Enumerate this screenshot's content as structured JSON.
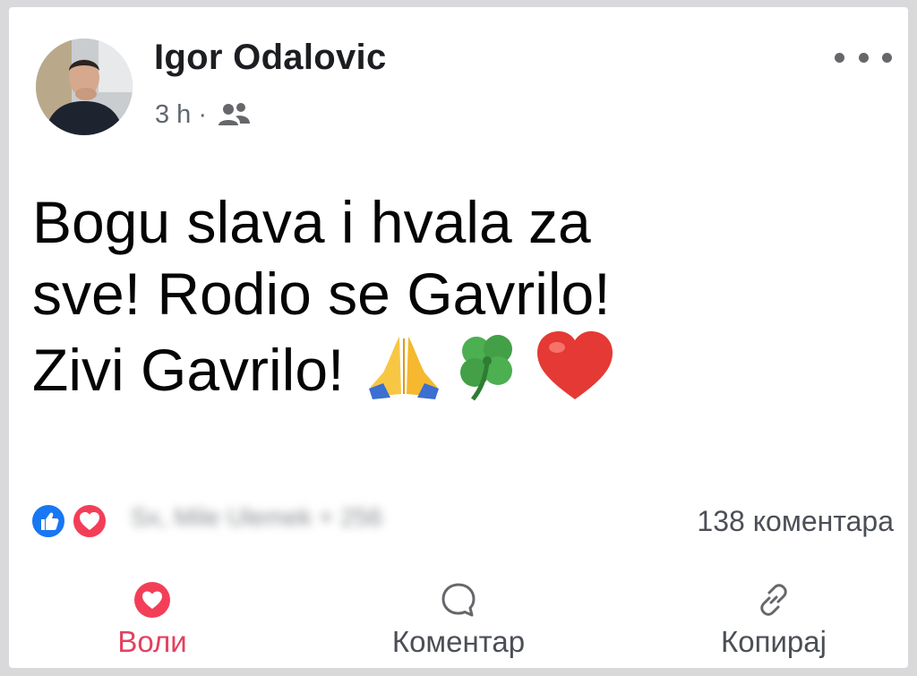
{
  "post": {
    "author": "Igor Odalovic",
    "time": "3 h",
    "separator": "·",
    "audience_icon": "friends-icon",
    "more_icon": "more-options-icon",
    "text_lines": [
      "Bogu slava i hvala za",
      "sve! Rodio se Gavrilo!",
      "Zivi Gavrilo!"
    ],
    "emojis": [
      "folded-hands-icon",
      "four-leaf-clover-icon",
      "red-heart-icon"
    ]
  },
  "reactions": {
    "icons": [
      "like-reaction-icon",
      "love-reaction-icon"
    ],
    "names_blurred": "Sx, Mile Ulemek + 256",
    "comments": "138 коментара"
  },
  "actions": {
    "like": "Воли",
    "comment": "Коментар",
    "copy": "Копирај"
  },
  "colors": {
    "love_accent": "#e4405f",
    "like_blue": "#1877f2",
    "love_red": "#f33e58",
    "text_dark": "#050505",
    "text_muted": "#606770"
  }
}
